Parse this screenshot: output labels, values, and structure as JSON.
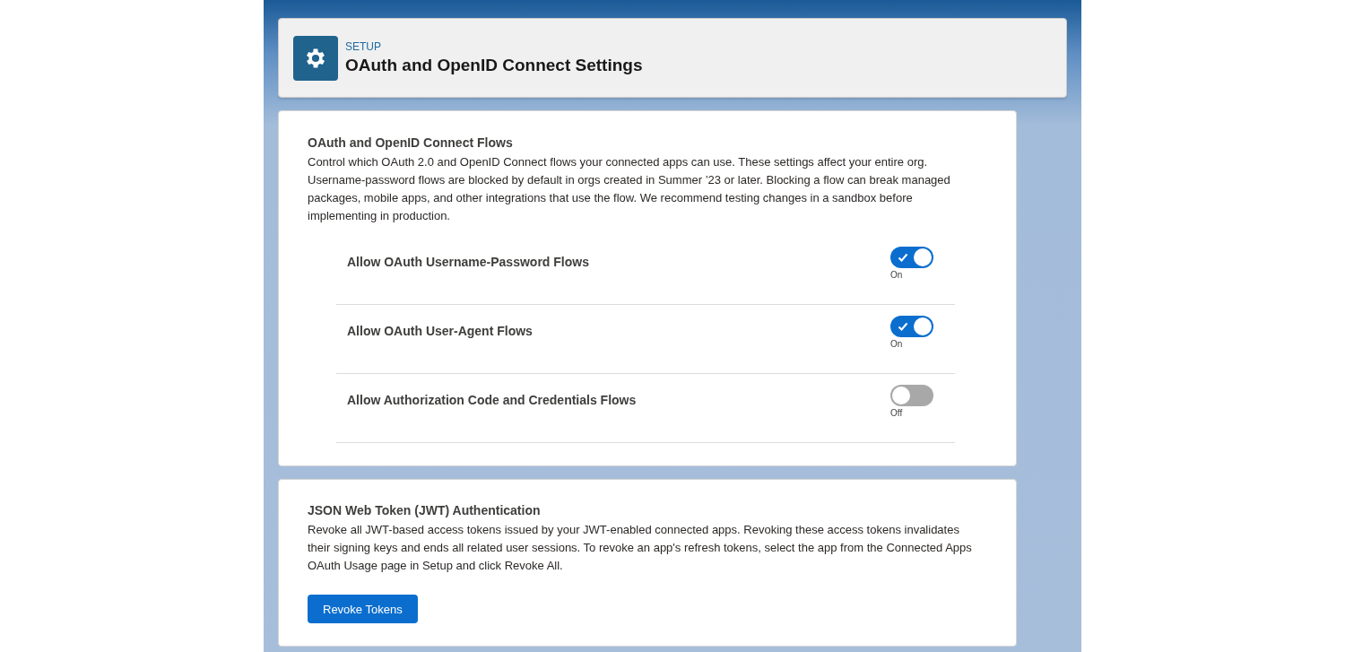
{
  "header": {
    "eyebrow": "SETUP",
    "title": "OAuth and OpenID Connect Settings"
  },
  "flows_section": {
    "title": "OAuth and OpenID Connect Flows",
    "description": "Control which OAuth 2.0 and OpenID Connect flows your connected apps can use. These settings affect your entire org. Username-password flows are blocked by default in orgs created in Summer ’23 or later. Blocking a flow can break managed packages, mobile apps, and other integrations that use the flow. We recommend testing changes in a sandbox before implementing in production.",
    "settings": [
      {
        "label": "Allow OAuth Username-Password Flows",
        "on": true,
        "state_label": "On"
      },
      {
        "label": "Allow OAuth User-Agent Flows",
        "on": true,
        "state_label": "On"
      },
      {
        "label": "Allow Authorization Code and Credentials Flows",
        "on": false,
        "state_label": "Off"
      }
    ]
  },
  "jwt_section": {
    "title": "JSON Web Token (JWT) Authentication",
    "description": "Revoke all JWT-based access tokens issued by your JWT-enabled connected apps. Revoking these access tokens invalidates their signing keys and ends all related user sessions. To revoke an app's refresh tokens, select the app from the Connected Apps OAuth Usage page in Setup and click Revoke All.",
    "button": "Revoke Tokens"
  }
}
